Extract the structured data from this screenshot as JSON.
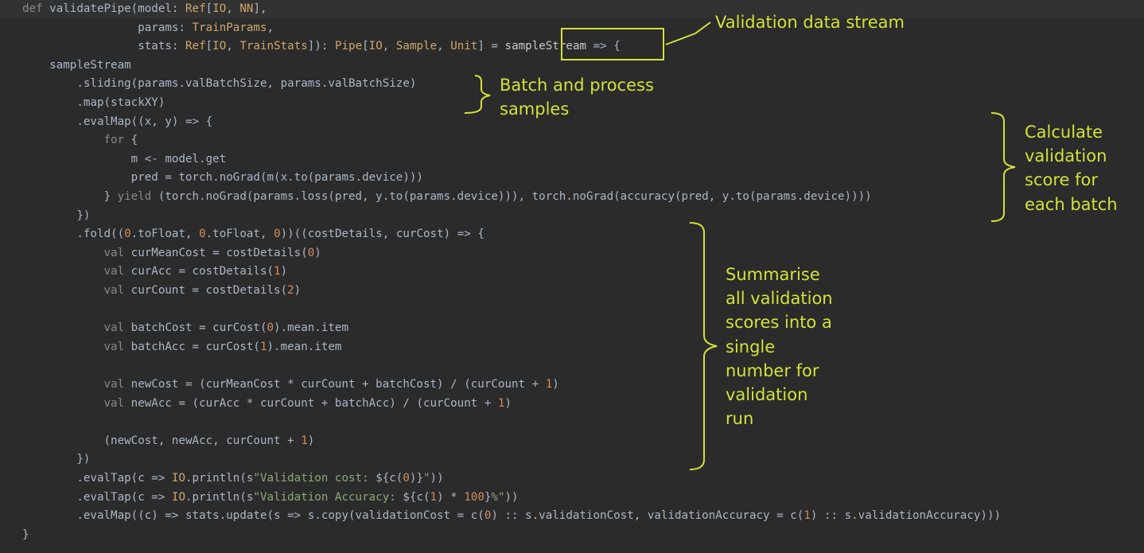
{
  "code": {
    "lines": [
      [
        [
          "def ",
          "kw"
        ],
        [
          "validatePipe(model: ",
          "pl"
        ],
        [
          "Ref",
          "tp"
        ],
        [
          "[",
          "pl"
        ],
        [
          "IO",
          "tp"
        ],
        [
          ", ",
          "pl"
        ],
        [
          "NN",
          "tp"
        ],
        [
          "],",
          "pl"
        ]
      ],
      [
        [
          "                 params: ",
          "pl"
        ],
        [
          "TrainParams",
          "tp"
        ],
        [
          ",",
          "pl"
        ]
      ],
      [
        [
          "                 stats: ",
          "pl"
        ],
        [
          "Ref",
          "tp"
        ],
        [
          "[",
          "pl"
        ],
        [
          "IO",
          "tp"
        ],
        [
          ", ",
          "pl"
        ],
        [
          "TrainStats",
          "tp"
        ],
        [
          "]): ",
          "pl"
        ],
        [
          "Pipe",
          "tp"
        ],
        [
          "[",
          "pl"
        ],
        [
          "IO",
          "tp"
        ],
        [
          ", ",
          "pl"
        ],
        [
          "Sample",
          "tp"
        ],
        [
          ", ",
          "pl"
        ],
        [
          "Unit",
          "tp"
        ],
        [
          "] = ",
          "pl"
        ],
        [
          "sampleStream",
          "fn"
        ],
        [
          " => {",
          "pl"
        ]
      ],
      [
        [
          "    sampleStream",
          "pl"
        ]
      ],
      [
        [
          "        .sliding(params.valBatchSize, params.valBatchSize)",
          "pl"
        ]
      ],
      [
        [
          "        .map(stackXY)",
          "pl"
        ]
      ],
      [
        [
          "        .evalMap((x, y) => {",
          "pl"
        ]
      ],
      [
        [
          "            ",
          "pl"
        ],
        [
          "for",
          "kw"
        ],
        [
          " {",
          "pl"
        ]
      ],
      [
        [
          "                m <- model.get",
          "pl"
        ]
      ],
      [
        [
          "                pred = torch.noGrad(m(x.to(params.device)))",
          "pl"
        ]
      ],
      [
        [
          "            } ",
          "pl"
        ],
        [
          "yield",
          "kw"
        ],
        [
          " (torch.noGrad(params.loss(pred, y.to(params.device))), torch.noGrad(accuracy(pred, y.to(params.device))))",
          "pl"
        ]
      ],
      [
        [
          "        })",
          "pl"
        ]
      ],
      [
        [
          "        .fold((",
          "pl"
        ],
        [
          "0",
          "num"
        ],
        [
          ".toFloat, ",
          "pl"
        ],
        [
          "0",
          "num"
        ],
        [
          ".toFloat, ",
          "pl"
        ],
        [
          "0",
          "num"
        ],
        [
          "))((costDetails, curCost) => {",
          "pl"
        ]
      ],
      [
        [
          "            ",
          "pl"
        ],
        [
          "val",
          "kw"
        ],
        [
          " curMeanCost = costDetails(",
          "pl"
        ],
        [
          "0",
          "num"
        ],
        [
          ")",
          "pl"
        ]
      ],
      [
        [
          "            ",
          "pl"
        ],
        [
          "val",
          "kw"
        ],
        [
          " curAcc = costDetails(",
          "pl"
        ],
        [
          "1",
          "num"
        ],
        [
          ")",
          "pl"
        ]
      ],
      [
        [
          "            ",
          "pl"
        ],
        [
          "val",
          "kw"
        ],
        [
          " curCount = costDetails(",
          "pl"
        ],
        [
          "2",
          "num"
        ],
        [
          ")",
          "pl"
        ]
      ],
      [
        [
          "",
          "pl"
        ]
      ],
      [
        [
          "            ",
          "pl"
        ],
        [
          "val",
          "kw"
        ],
        [
          " batchCost = curCost(",
          "pl"
        ],
        [
          "0",
          "num"
        ],
        [
          ").mean.item",
          "pl"
        ]
      ],
      [
        [
          "            ",
          "pl"
        ],
        [
          "val",
          "kw"
        ],
        [
          " batchAcc = curCost(",
          "pl"
        ],
        [
          "1",
          "num"
        ],
        [
          ").mean.item",
          "pl"
        ]
      ],
      [
        [
          "",
          "pl"
        ]
      ],
      [
        [
          "            ",
          "pl"
        ],
        [
          "val",
          "kw"
        ],
        [
          " newCost = (curMeanCost * curCount + batchCost) / (curCount + ",
          "pl"
        ],
        [
          "1",
          "num"
        ],
        [
          ")",
          "pl"
        ]
      ],
      [
        [
          "            ",
          "pl"
        ],
        [
          "val",
          "kw"
        ],
        [
          " newAcc = (curAcc * curCount + batchAcc) / (curCount + ",
          "pl"
        ],
        [
          "1",
          "num"
        ],
        [
          ")",
          "pl"
        ]
      ],
      [
        [
          "",
          "pl"
        ]
      ],
      [
        [
          "            (newCost, newAcc, curCount + ",
          "pl"
        ],
        [
          "1",
          "num"
        ],
        [
          ")",
          "pl"
        ]
      ],
      [
        [
          "        })",
          "pl"
        ]
      ],
      [
        [
          "        .evalTap(c => ",
          "pl"
        ],
        [
          "IO",
          "tp"
        ],
        [
          ".println(s",
          "pl"
        ],
        [
          "\"Validation cost: ",
          "str"
        ],
        [
          "${c(",
          "pl"
        ],
        [
          "0",
          "num"
        ],
        [
          ")}",
          "pl"
        ],
        [
          "\"",
          "str"
        ],
        [
          "))",
          "pl"
        ]
      ],
      [
        [
          "        .evalTap(c => ",
          "pl"
        ],
        [
          "IO",
          "tp"
        ],
        [
          ".println(s",
          "pl"
        ],
        [
          "\"Validation Accuracy: ",
          "str"
        ],
        [
          "${c(",
          "pl"
        ],
        [
          "1",
          "num"
        ],
        [
          ") * ",
          "pl"
        ],
        [
          "100",
          "num"
        ],
        [
          "}",
          "pl"
        ],
        [
          "%\"",
          "str"
        ],
        [
          "))",
          "pl"
        ]
      ],
      [
        [
          "        .evalMap((c) => stats.update(s => s.copy(validationCost = c(",
          "pl"
        ],
        [
          "0",
          "num"
        ],
        [
          ") :: s.validationCost, validationAccuracy = c(",
          "pl"
        ],
        [
          "1",
          "num"
        ],
        [
          ") :: s.validationAccuracy)))",
          "pl"
        ]
      ],
      [
        [
          "}",
          "pl"
        ]
      ]
    ]
  },
  "annotations": {
    "validation_stream": "Validation data stream",
    "batch_process": [
      "Batch and process",
      "samples"
    ],
    "calc_score": [
      "Calculate",
      "validation",
      "score for",
      "each batch"
    ],
    "summarise": [
      "Summarise",
      "all validation",
      "scores into a",
      "single",
      "number for",
      "validation",
      "run"
    ]
  },
  "colors": {
    "background": "#2b2b2b",
    "annotation": "#d4e03a",
    "keyword": "#8a8a8a",
    "type": "#cfa86a",
    "number": "#cf8e5e",
    "string": "#8aa878",
    "plain": "#a9b7c6"
  }
}
